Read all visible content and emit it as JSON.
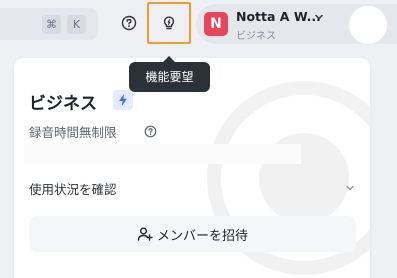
{
  "search": {
    "shortcut_cmd": "⌘",
    "shortcut_key": "K"
  },
  "header": {
    "help_icon": "question-circle-icon",
    "feature_request_icon": "lightbulb-icon"
  },
  "tooltip": {
    "text": "機能要望"
  },
  "account": {
    "logo_letter": "N",
    "name": "Notta A W...",
    "plan": "ビジネス",
    "logo_color": "#e8445c"
  },
  "panel": {
    "plan_title": "ビジネス",
    "recording_limit": "録音時間無制限",
    "usage_link": "使用状況を確認",
    "invite_button": "メンバーを招待"
  },
  "colors": {
    "highlight": "#f29a2e",
    "tooltip_bg": "#2c3138",
    "bolt": "#3b6cf6"
  }
}
